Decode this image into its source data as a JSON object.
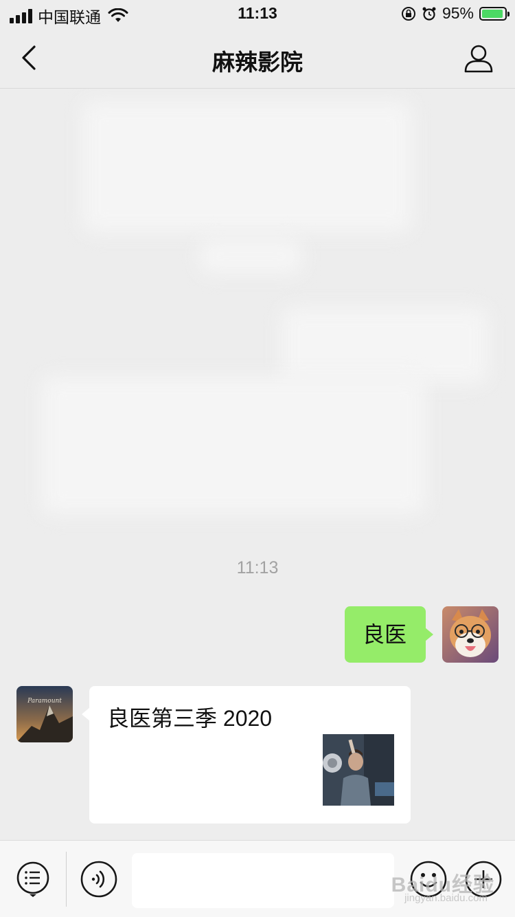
{
  "status_bar": {
    "carrier": "中国联通",
    "time": "11:13",
    "battery_percent": "95%",
    "battery_level": 0.95,
    "icons": [
      "signal-icon",
      "wifi-icon",
      "orientation-lock-icon",
      "alarm-icon",
      "battery-charging-icon"
    ]
  },
  "nav": {
    "title": "麻辣影院",
    "back_icon": "chevron-left-icon",
    "profile_icon": "person-icon"
  },
  "chat": {
    "timestamp": "11:13",
    "messages": [
      {
        "side": "self",
        "text": "良医"
      },
      {
        "side": "other",
        "type": "card",
        "title": "良医第三季 2020"
      }
    ]
  },
  "input_bar": {
    "icons": [
      "list-menu-icon",
      "voice-icon",
      "emoji-icon",
      "plus-icon"
    ],
    "placeholder": ""
  },
  "watermark": {
    "text": "Baidu经验",
    "url": "jingyan.baidu.com"
  },
  "colors": {
    "background": "#ededed",
    "self_bubble": "#95ec69",
    "card_bg": "#ffffff",
    "timestamp": "#a2a2a2"
  }
}
